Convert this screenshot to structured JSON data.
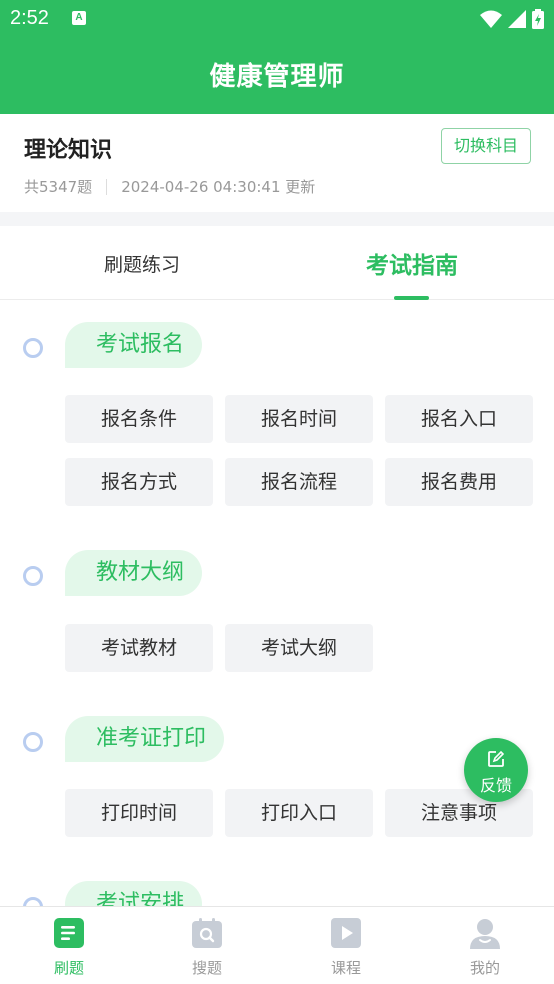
{
  "status_bar": {
    "time": "2:52",
    "notification_badge": "A"
  },
  "header": {
    "title": "健康管理师"
  },
  "subject": {
    "title": "理论知识",
    "switch_label": "切换科目",
    "count": "共5347题",
    "updated": "2024-04-26 04:30:41 更新"
  },
  "tabs": [
    {
      "label": "刷题练习",
      "active": false
    },
    {
      "label": "考试指南",
      "active": true
    }
  ],
  "sections": [
    {
      "title": "考试报名",
      "items": [
        "报名条件",
        "报名时间",
        "报名入口",
        "报名方式",
        "报名流程",
        "报名费用"
      ]
    },
    {
      "title": "教材大纲",
      "items": [
        "考试教材",
        "考试大纲"
      ]
    },
    {
      "title": "准考证打印",
      "items": [
        "打印时间",
        "打印入口",
        "注意事项"
      ]
    },
    {
      "title": "考试安排",
      "items": []
    }
  ],
  "feedback": {
    "label": "反馈",
    "icon": "edit-icon"
  },
  "bottom_nav": [
    {
      "label": "刷题",
      "icon": "document-icon",
      "active": true
    },
    {
      "label": "搜题",
      "icon": "search-icon",
      "active": false
    },
    {
      "label": "课程",
      "icon": "play-icon",
      "active": false
    },
    {
      "label": "我的",
      "icon": "user-icon",
      "active": false
    }
  ],
  "colors": {
    "brand": "#2dbd61",
    "pill_bg": "#e3f8ea",
    "dot_border": "#b9cdf0",
    "button_bg": "#f2f3f5"
  }
}
